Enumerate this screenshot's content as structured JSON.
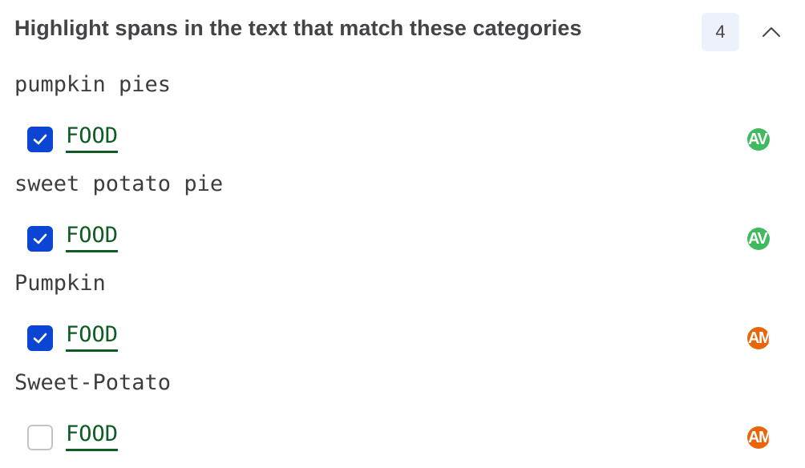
{
  "header": {
    "title": "Highlight spans in the text that match these categories",
    "count": "4",
    "toggle_icon": "chevron-up-icon"
  },
  "colors": {
    "checkbox_checked": "#0b45d3",
    "category_text": "#0e5b23"
  },
  "items": [
    {
      "text": "pumpkin pies",
      "category": "FOOD",
      "checked": true,
      "annotator": {
        "initials": "AV",
        "color": "#3fba5f"
      }
    },
    {
      "text": "sweet potato pie",
      "category": "FOOD",
      "checked": true,
      "annotator": {
        "initials": "AV",
        "color": "#3fba5f"
      }
    },
    {
      "text": "Pumpkin",
      "category": "FOOD",
      "checked": true,
      "annotator": {
        "initials": "AM",
        "color": "#e8650a"
      }
    },
    {
      "text": "Sweet-Potato",
      "category": "FOOD",
      "checked": false,
      "annotator": {
        "initials": "AM",
        "color": "#e8650a"
      }
    }
  ]
}
